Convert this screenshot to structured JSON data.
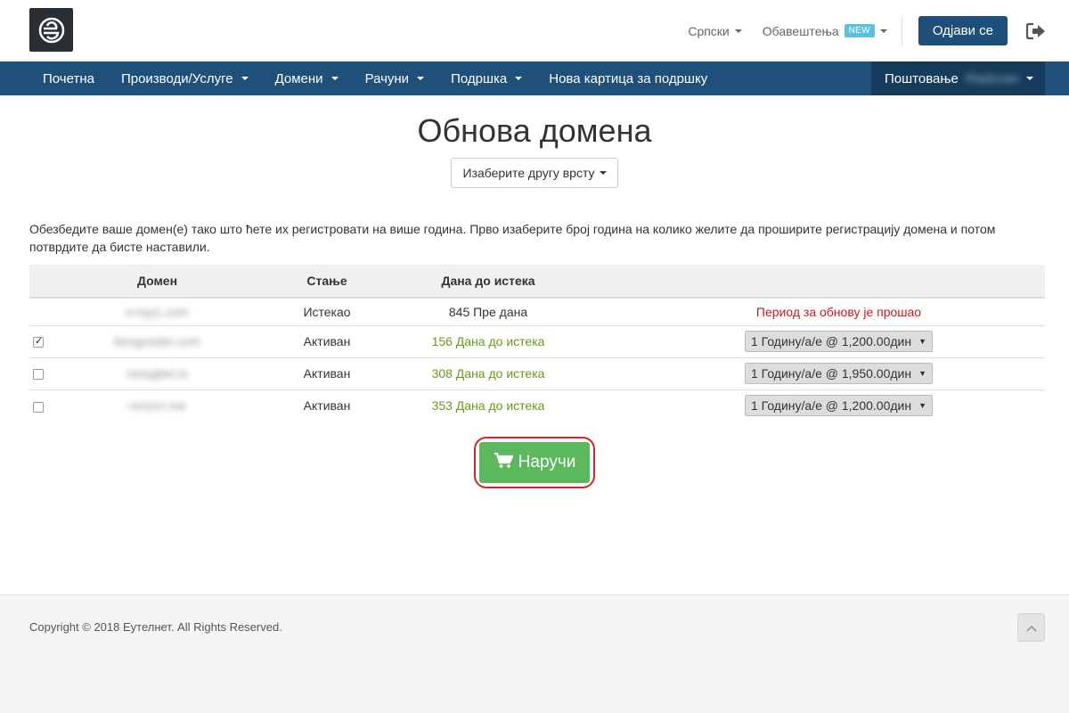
{
  "header": {
    "logo_icon": "eutelnet-logo-icon",
    "language_label": "Српски",
    "notifications_label": "Обавештења",
    "notifications_badge": "NEW",
    "logout_label": "Одјави се",
    "logout_icon": "sign-out-icon"
  },
  "navbar": {
    "items": [
      {
        "label": "Почетна",
        "dropdown": false
      },
      {
        "label": "Производи/Услуге",
        "dropdown": true
      },
      {
        "label": "Домени",
        "dropdown": true
      },
      {
        "label": "Рачуни",
        "dropdown": true
      },
      {
        "label": "Подршка",
        "dropdown": true
      },
      {
        "label": "Нова картица за подршку",
        "dropdown": false
      }
    ],
    "greeting": "Поштовање",
    "user_name": "Radovan"
  },
  "main": {
    "title": "Обнова домена",
    "type_dropdown_label": "Изаберите другу врсту",
    "intro": "Обезбедите ваше домен(е) тако што ћете их регистровати на више година. Прво изаберите број година на колико желите да проширите регистрацију домена и потом потврдите да бисте наставили."
  },
  "table": {
    "headers": [
      "Домен",
      "Стање",
      "Дана до истека",
      ""
    ],
    "rows": [
      {
        "checkbox": false,
        "checked": false,
        "domain": "e-top1.com",
        "status": "Истекао",
        "days": "845 Пре дана",
        "days_color": "default",
        "action": "Период за обнову је прошао",
        "action_type": "text"
      },
      {
        "checkbox": true,
        "checked": true,
        "domain": "beograster.com",
        "status": "Активан",
        "days": "156 Дана до истека",
        "days_color": "green",
        "action": "1 Годину/а/е @ 1,200.00дин",
        "action_type": "select"
      },
      {
        "checkbox": true,
        "checked": false,
        "domain": "netsgbel.rs",
        "status": "Активан",
        "days": "308 Дана до истека",
        "days_color": "green",
        "action": "1 Годину/а/е @ 1,950.00дин",
        "action_type": "select"
      },
      {
        "checkbox": true,
        "checked": false,
        "domain": "rsrszcr.me",
        "status": "Активан",
        "days": "353 Дана до истека",
        "days_color": "green",
        "action": "1 Годину/а/е @ 1,200.00дин",
        "action_type": "select"
      }
    ]
  },
  "order_button": {
    "label": "Наручи",
    "icon": "shopping-cart-icon"
  },
  "footer": {
    "copyright": "Copyright © 2018 Еутелнет. All Rights Reserved.",
    "back_to_top_icon": "chevron-up-icon"
  },
  "colors": {
    "navbar": "#1f5079",
    "navbar_user": "#163c5d",
    "logout_button": "#1e4f7b",
    "order_button": "#5cb85c",
    "highlight_ring": "#d2232a",
    "days_green": "#6a9a17",
    "warning_red": "#c7191f"
  }
}
